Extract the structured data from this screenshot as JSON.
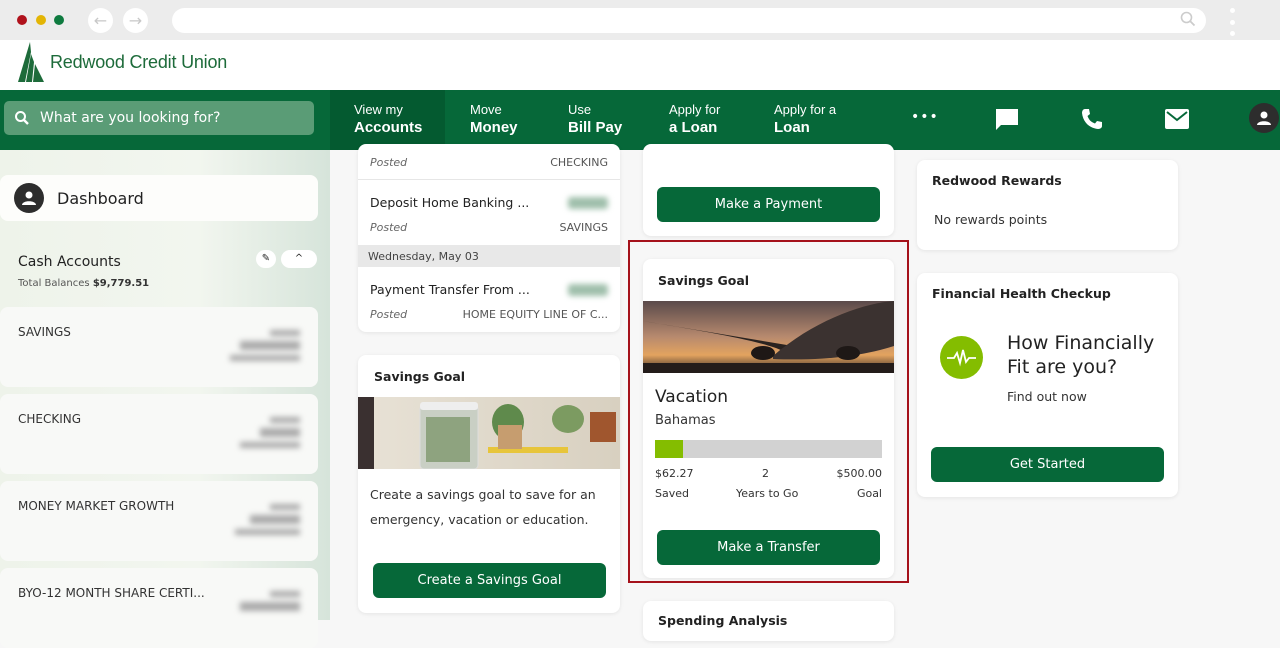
{
  "browser": {
    "dots": {
      "red": "#b0121c",
      "yellow": "#e3b505",
      "green": "#0e7a3f"
    },
    "back_icon": "arrow-left-icon",
    "forward_icon": "arrow-right-icon",
    "back": "←",
    "forward": "→",
    "search_glyph": "⚲"
  },
  "brand": {
    "name": "Redwood Credit Union",
    "color": "#066839"
  },
  "nav": {
    "search_placeholder": "What are you looking for?",
    "search_glyph": "🔍",
    "items": [
      {
        "line1": "View my",
        "line2": "Accounts",
        "active": true
      },
      {
        "line1": "Move",
        "line2": "Money"
      },
      {
        "line1": "Use",
        "line2": "Bill Pay"
      },
      {
        "line1": "Apply for",
        "line2": "a Loan"
      },
      {
        "line1": "Apply for a",
        "line2": "Loan"
      }
    ],
    "more_glyph": "•••"
  },
  "sidebar": {
    "dashboard_label": "Dashboard",
    "cash_accounts_title": "Cash Accounts",
    "total_label": "Total Balances",
    "total_value": "$9,779.51",
    "edit_glyph": "✎",
    "collapse_glyph": "^",
    "accounts": [
      {
        "name": "SAVINGS"
      },
      {
        "name": "CHECKING"
      },
      {
        "name": "MONEY MARKET GROWTH"
      },
      {
        "name": "BYO-12 MONTH SHARE CERTI..."
      }
    ]
  },
  "transactions": {
    "rows": [
      {
        "status": "Posted",
        "account": "CHECKING"
      },
      {
        "name": "Deposit Home Banking ...",
        "status": "Posted",
        "account": "SAVINGS"
      },
      {
        "date": "Wednesday, May 03"
      },
      {
        "name": "Payment Transfer From ...",
        "status": "Posted",
        "account": "HOME EQUITY LINE OF C..."
      }
    ]
  },
  "savings_goal_create": {
    "title": "Savings Goal",
    "description": "Create a savings goal to save for an emergency, vacation or education.",
    "button": "Create a Savings Goal"
  },
  "loan_card": {
    "button": "Make a Payment"
  },
  "savings_goal_vacation": {
    "title": "Savings Goal",
    "goal_name": "Vacation",
    "destination": "Bahamas",
    "progress_fraction": 0.1245,
    "saved_value": "$62.27",
    "saved_label": "Saved",
    "years_value": "2",
    "years_label": "Years to Go",
    "goal_value": "$500.00",
    "goal_label": "Goal",
    "button": "Make a Transfer",
    "progress_color": "#84bd00"
  },
  "spending": {
    "title": "Spending Analysis"
  },
  "rewards": {
    "title": "Redwood Rewards",
    "text": "No rewards points"
  },
  "health": {
    "title": "Financial Health Checkup",
    "headline": "How Financially Fit are you?",
    "subtext": "Find out now",
    "button": "Get Started",
    "icon_color": "#84bd00"
  }
}
